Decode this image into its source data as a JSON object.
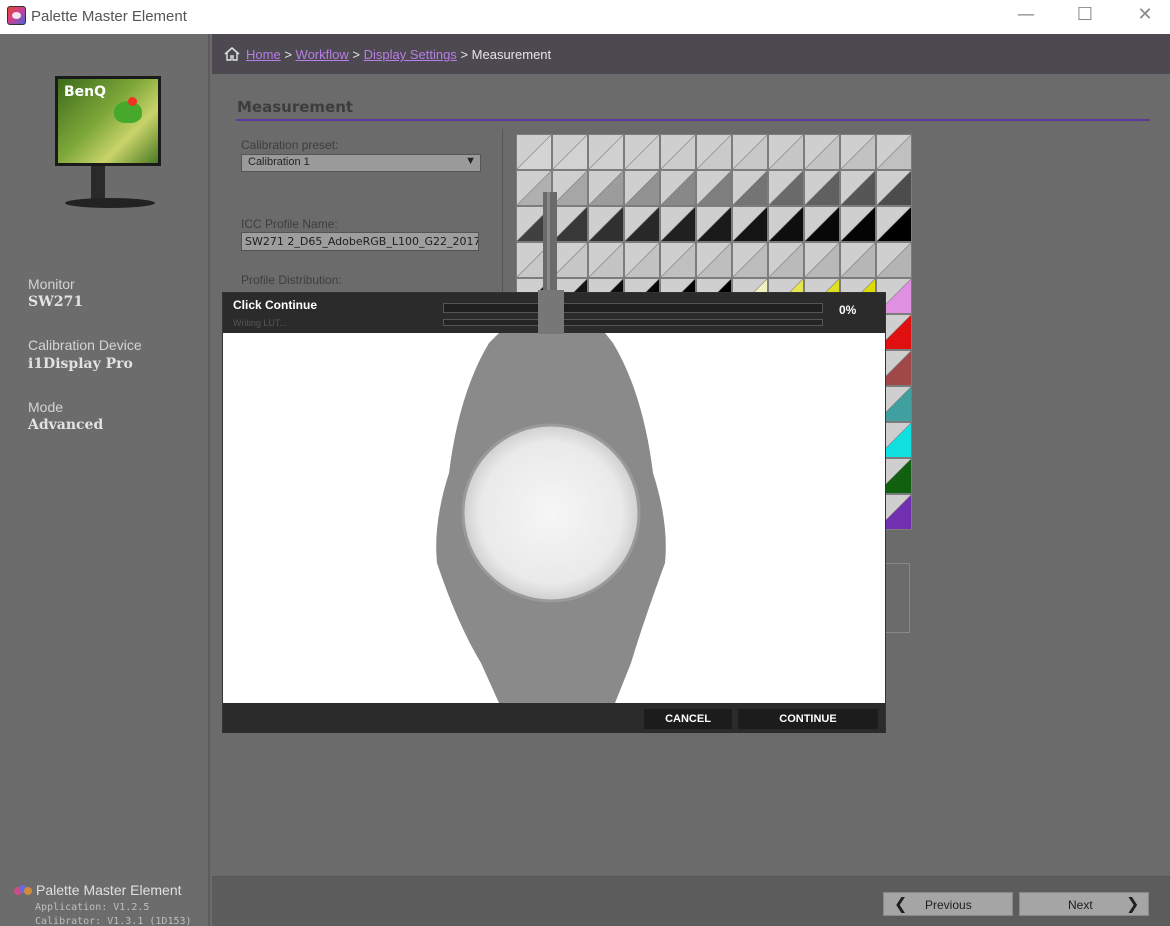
{
  "window": {
    "title": "Palette Master Element",
    "controls": {
      "minimize": "—",
      "maximize": "☐",
      "close": "✕"
    }
  },
  "breadcrumb": {
    "home": "Home",
    "sep": ">",
    "workflow": "Workflow",
    "display_settings": "Display Settings",
    "current": "Measurement"
  },
  "sidebar": {
    "monitor_brand": "BenQ",
    "monitor_label": "Monitor",
    "monitor_value": "SW271",
    "device_label": "Calibration Device",
    "device_value": "i1Display Pro",
    "mode_label": "Mode",
    "mode_value": "Advanced",
    "brand": "Palette Master Element",
    "app_version": "Application: V1.2.5",
    "calibrator_version": "Calibrator: V1.3.1 (1D153)"
  },
  "main": {
    "heading": "Measurement",
    "preset_label": "Calibration preset:",
    "preset_value": "Calibration 1",
    "icc_label": "ICC Profile Name:",
    "icc_value": "SW271 2_D65_AdobeRGB_L100_G22_2017",
    "distribution_label": "Profile Distribution:"
  },
  "patch_grid": {
    "rows": [
      [
        "#d4d4d4",
        "#d2d2d2",
        "#d0d0d0",
        "#cecece",
        "#cccccc",
        "#cacaca",
        "#c8c8c8",
        "#c6c6c6",
        "#c4c4c4",
        "#c2c2c2",
        "#c0c0c0"
      ],
      [
        "#b0b0b0",
        "#a6a6a6",
        "#9c9c9c",
        "#929292",
        "#888888",
        "#7e7e7e",
        "#747474",
        "#6a6a6a",
        "#606060",
        "#565656",
        "#4c4c4c"
      ],
      [
        "#404040",
        "#383838",
        "#303030",
        "#282828",
        "#202020",
        "#1a1a1a",
        "#141414",
        "#0e0e0e",
        "#080808",
        "#040404",
        "#000000"
      ],
      [
        "#c8c8c8",
        "#c6c6c6",
        "#c4c4c4",
        "#c2c2c2",
        "#c0c0c0",
        "#bebebe",
        "#bcbcbc",
        "#bababa",
        "#b8b8b8",
        "#b6b6b6",
        "#b4b4b4"
      ],
      [
        "#1a1a1a",
        "#141414",
        "#0e0e0e",
        "#080808",
        "#040404",
        "#000000",
        "#f0f0c0",
        "#e6e650",
        "#e0e020",
        "#dcdc00",
        "#e090e0"
      ],
      [
        "#d0d0d0",
        "#d0d0d0",
        "#d0d0d0",
        "#d0d0d0",
        "#d0d0d0",
        "#d0d0d0",
        "#d0d0d0",
        "#d0d0d0",
        "#d0d0d0",
        "#d0d0d0",
        "#e01010"
      ],
      [
        "#d0d0d0",
        "#d0d0d0",
        "#d0d0d0",
        "#d0d0d0",
        "#d0d0d0",
        "#d0d0d0",
        "#d0d0d0",
        "#d0d0d0",
        "#d0d0d0",
        "#d0d0d0",
        "#a04848"
      ],
      [
        "#d0d0d0",
        "#d0d0d0",
        "#d0d0d0",
        "#d0d0d0",
        "#d0d0d0",
        "#d0d0d0",
        "#d0d0d0",
        "#d0d0d0",
        "#d0d0d0",
        "#d0d0d0",
        "#40a0a0"
      ],
      [
        "#d0d0d0",
        "#d0d0d0",
        "#d0d0d0",
        "#d0d0d0",
        "#d0d0d0",
        "#d0d0d0",
        "#d0d0d0",
        "#d0d0d0",
        "#d0d0d0",
        "#d0d0d0",
        "#10e0e0"
      ],
      [
        "#d0d0d0",
        "#d0d0d0",
        "#d0d0d0",
        "#d0d0d0",
        "#d0d0d0",
        "#d0d0d0",
        "#d0d0d0",
        "#d0d0d0",
        "#d0d0d0",
        "#d0d0d0",
        "#106010"
      ],
      [
        "#d0d0d0",
        "#d0d0d0",
        "#d0d0d0",
        "#d0d0d0",
        "#d0d0d0",
        "#d0d0d0",
        "#d0d0d0",
        "#d0d0d0",
        "#d0d0d0",
        "#d0d0d0",
        "#7030b0"
      ]
    ]
  },
  "dialog": {
    "title": "Click Continue",
    "subtitle": "Writing LUT...",
    "progress_percent": "0%",
    "progress_fraction": 0,
    "cancel_label": "CANCEL",
    "continue_label": "CONTINUE"
  },
  "nav": {
    "previous_label": "Previous",
    "next_label": "Next"
  },
  "colors": {
    "accent": "#5f3a9e",
    "link": "#b97de6"
  }
}
